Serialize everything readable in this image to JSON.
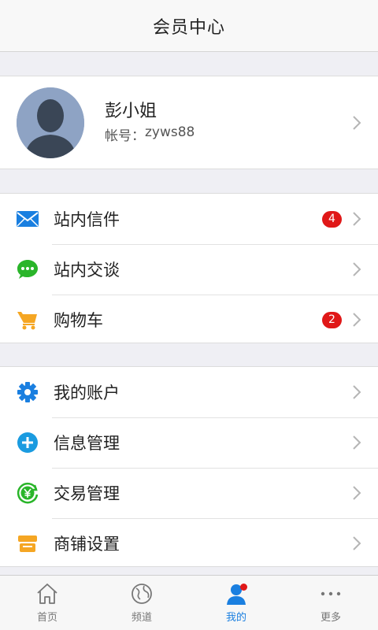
{
  "header": {
    "title": "会员中心"
  },
  "profile": {
    "name": "彭小姐",
    "account_label": "帐号：",
    "account_value": "zyws88"
  },
  "group1": [
    {
      "label": "站内信件",
      "icon": "mail-icon",
      "badge": "4"
    },
    {
      "label": "站内交谈",
      "icon": "chat-icon",
      "badge": ""
    },
    {
      "label": "购物车",
      "icon": "cart-icon",
      "badge": "2"
    }
  ],
  "group2": [
    {
      "label": "我的账户",
      "icon": "gear-icon"
    },
    {
      "label": "信息管理",
      "icon": "plus-circle-icon"
    },
    {
      "label": "交易管理",
      "icon": "yuan-exchange-icon"
    },
    {
      "label": "商铺设置",
      "icon": "shop-icon"
    }
  ],
  "tabbar": [
    {
      "label": "首页",
      "icon": "home-icon"
    },
    {
      "label": "频道",
      "icon": "globe-icon"
    },
    {
      "label": "我的",
      "icon": "user-icon",
      "active": true
    },
    {
      "label": "更多",
      "icon": "more-icon"
    }
  ],
  "colors": {
    "accent": "#1a7fe0",
    "badge": "#e01818",
    "mail": "#1a7fe0",
    "chat": "#2ab52a",
    "cart": "#f5a623",
    "gear": "#1a7fe0",
    "plus": "#1a9be0",
    "yuan": "#2ab52a",
    "shop": "#f5a623"
  }
}
